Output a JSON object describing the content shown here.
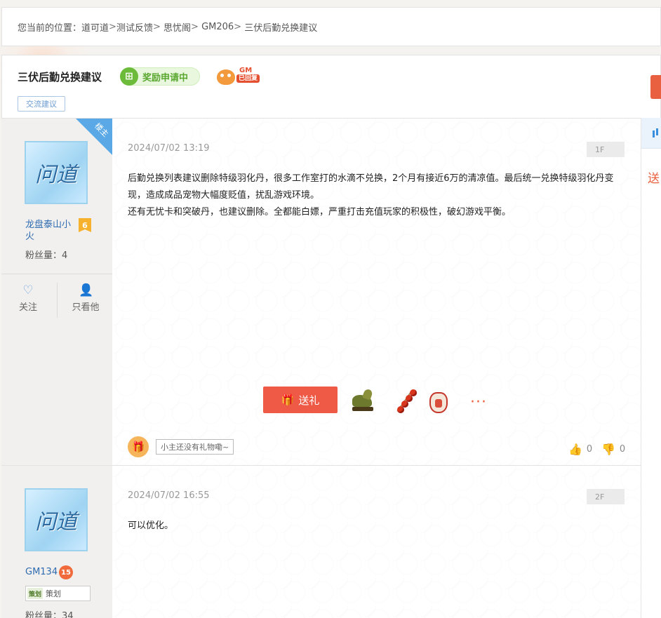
{
  "breadcrumb": {
    "prefix": "您当前的位置：",
    "items": [
      "道可道",
      "测试反馈",
      "思忧阁",
      "GM206",
      "三伏后勤兑换建议"
    ],
    "separator": ">"
  },
  "thread": {
    "title": "三伏后勤兑换建议",
    "reward_badge": "奖励申请中",
    "gm_badge_top": "GM",
    "gm_badge_bottom": "已回复",
    "tag": "交流建议"
  },
  "right_sidebar": {
    "send_label": "送"
  },
  "posts": [
    {
      "owner_ribbon": "楼主",
      "avatar_glyph": "问道",
      "username": "龙盘泰山小火",
      "level": "6",
      "fans": "粉丝量：4",
      "follow_label": "关注",
      "only_view_label": "只看他",
      "timestamp": "2024/07/02 13:19",
      "floor": "1F",
      "content_line1": "后勤兑换列表建议删除特级羽化丹，很多工作室打的水滴不兑换，2个月有接近6万的清凉值。最后统一兑换特级羽化丹变现，造成成品宠物大幅度贬值，扰乱游戏环境。",
      "content_line2": "还有无忧卡和突破丹，也建议删除。全都能白嫖，严重打击充值玩家的积极性，破幻游戏平衡。",
      "gift_button": "送礼",
      "more": "···",
      "no_gift_text": "小主还没有礼物嘞~",
      "like_count": "0",
      "dislike_count": "0"
    },
    {
      "avatar_glyph": "问道",
      "username": "GM134",
      "level": "15",
      "role_icon": "策划",
      "role": "策划",
      "fans": "粉丝量：34",
      "timestamp": "2024/07/02 16:55",
      "floor": "2F",
      "content": "可以优化。"
    }
  ],
  "colors": {
    "accent_red": "#ee5a45",
    "link_blue": "#2e6bb0",
    "reward_green": "#5aa830",
    "owner_ribbon_blue": "#5aa9e6"
  }
}
